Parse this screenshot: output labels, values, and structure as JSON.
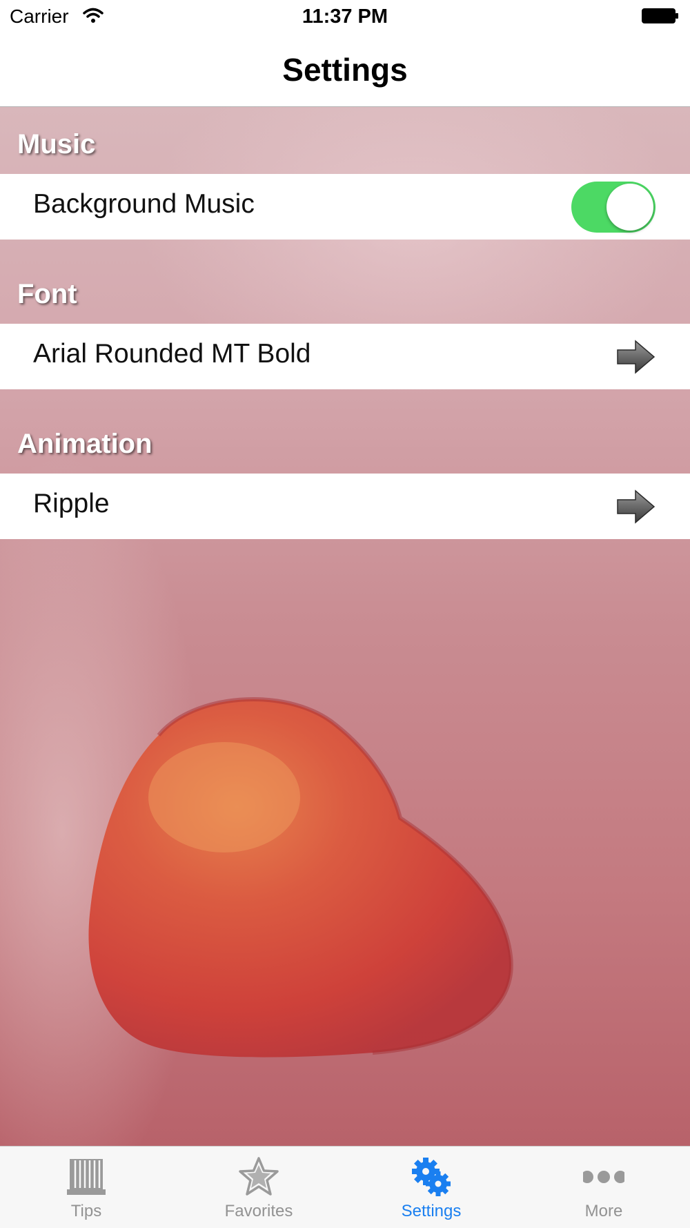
{
  "status_bar": {
    "carrier": "Carrier",
    "time": "11:37 PM",
    "icons": [
      "wifi-icon",
      "battery-icon"
    ]
  },
  "nav_bar": {
    "title": "Settings"
  },
  "sections": [
    {
      "header": "Music",
      "cell": {
        "label": "Background Music",
        "control": "toggle",
        "on": true
      }
    },
    {
      "header": "Font",
      "cell": {
        "label": "Arial Rounded MT Bold",
        "control": "arrow-right-icon"
      }
    },
    {
      "header": "Animation",
      "cell": {
        "label": "Ripple",
        "control": "arrow-right-icon"
      }
    }
  ],
  "tab_bar": {
    "items": [
      {
        "label": "Tips",
        "icon": "book-icon",
        "active": false
      },
      {
        "label": "Favorites",
        "icon": "star-icon",
        "active": false
      },
      {
        "label": "Settings",
        "icon": "gear-icon",
        "active": true
      },
      {
        "label": "More",
        "icon": "more-dots-icon",
        "active": false
      }
    ]
  },
  "colors": {
    "toggle_on": "#4cd964",
    "tab_active": "#1a7ff0",
    "tab_inactive": "#929292",
    "background_pink": "#c98c92",
    "heart": "#d8443a"
  }
}
